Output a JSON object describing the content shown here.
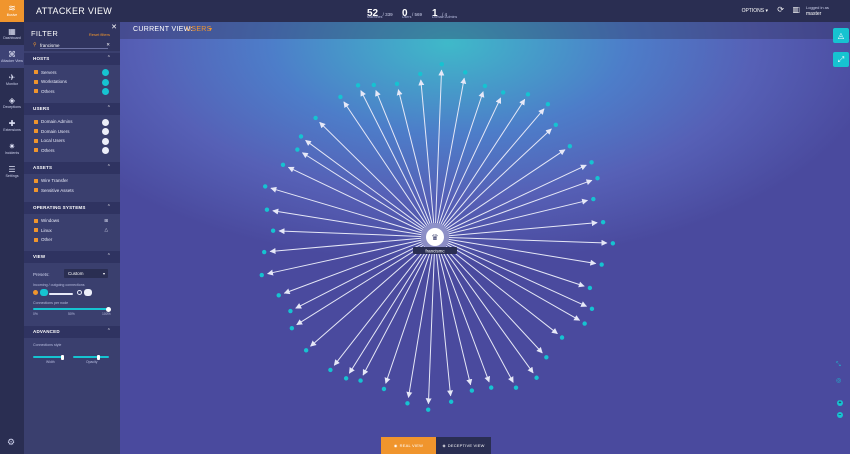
{
  "rail": {
    "logo_text": "illusive",
    "items": [
      {
        "label": "Dashboard",
        "icon": "dashboard-icon",
        "glyph": "▦"
      },
      {
        "label": "Attacker View",
        "icon": "attacker-view-icon",
        "glyph": "⌘"
      },
      {
        "label": "Monitor",
        "icon": "monitor-icon",
        "glyph": "✈"
      },
      {
        "label": "Deceptions",
        "icon": "deceptions-icon",
        "glyph": "◈"
      },
      {
        "label": "Extensions",
        "icon": "extensions-icon",
        "glyph": "✚"
      },
      {
        "label": "Incidents",
        "icon": "incidents-icon",
        "glyph": "✷"
      },
      {
        "label": "Settings",
        "icon": "settings-sliders-icon",
        "glyph": "☰"
      }
    ]
  },
  "topbar": {
    "title": "ATTACKER VIEW",
    "machines": {
      "value": "52",
      "total": "/ 339",
      "label": "Machines"
    },
    "users": {
      "value": "0",
      "total": "/ 569",
      "label": "Users"
    },
    "domain_admins": {
      "value": "1",
      "total": "/ 4",
      "label": "Domain Admins"
    },
    "options": "OPTIONS",
    "logged_in_label": "Logged in as",
    "username": "master"
  },
  "filter": {
    "title": "FILTER",
    "reset": "Reset filters",
    "search_value": "francisme",
    "hosts": {
      "title": "HOSTS",
      "items": [
        "Servers",
        "Workstations",
        "Others"
      ]
    },
    "users": {
      "title": "USERS",
      "items": [
        "Domain Admins",
        "Domain Users",
        "Local Users",
        "Others"
      ]
    },
    "assets": {
      "title": "ASSETS",
      "items": [
        "Wire Transfer",
        "Sensitive Assets"
      ]
    },
    "os": {
      "title": "OPERATING SYSTEMS",
      "items": [
        "Windows",
        "Linux",
        "Other"
      ]
    },
    "view": {
      "title": "VIEW",
      "presets_label": "Presets:",
      "preset_value": "Custom",
      "conn_label": "Incoming / outgoing connections",
      "per_node_label": "Connections per node",
      "scale_min": "0%",
      "scale_mid": "50%",
      "scale_max": "100%"
    },
    "advanced": {
      "title": "ADVANCED",
      "style_label": "Connections style",
      "width_label": "Width",
      "opacity_label": "Opacity"
    }
  },
  "main": {
    "current_view_label": "CURRENT VIEW:",
    "current_view_value": "USERS",
    "center_node_label": "francismc",
    "tab_real": "REAL VIEW",
    "tab_deceptive": "DECEPTIVE VIEW"
  },
  "graph": {
    "outer_node_count": 48,
    "node_color": "#16c3d1",
    "edge_color": "#e6e8f7"
  },
  "colors": {
    "accent": "#f0952d",
    "teal": "#16c3d1",
    "sidebar": "#2a2e52",
    "panel": "#3a3f6e"
  }
}
